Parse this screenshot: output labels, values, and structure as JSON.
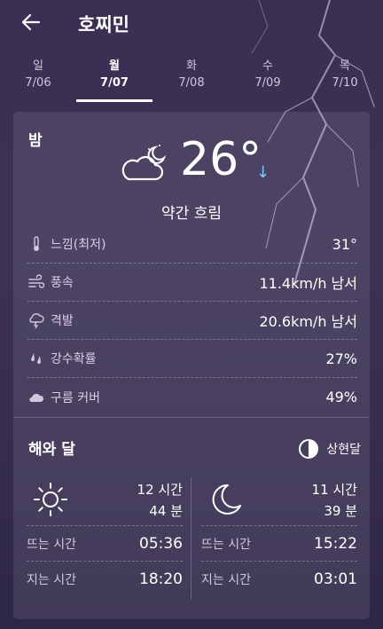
{
  "header": {
    "city": "호찌민"
  },
  "tabs": [
    {
      "day": "일",
      "date": "7/06"
    },
    {
      "day": "월",
      "date": "7/07"
    },
    {
      "day": "화",
      "date": "7/08"
    },
    {
      "day": "수",
      "date": "7/09"
    },
    {
      "day": "목",
      "date": "7/10"
    }
  ],
  "current": {
    "period": "밤",
    "temperature": "26°",
    "trend_arrow": "↓",
    "condition": "약간 흐림",
    "icon": "partly-cloudy-night-icon"
  },
  "details": [
    {
      "icon": "thermometer-icon",
      "label": "느낌(최저)",
      "value": "31°"
    },
    {
      "icon": "wind-icon",
      "label": "풍속",
      "value": "11.4km/h 남서"
    },
    {
      "icon": "gust-icon",
      "label": "격발",
      "value": "20.6km/h 남서"
    },
    {
      "icon": "rain-icon",
      "label": "강수확률",
      "value": "27%"
    },
    {
      "icon": "cloud-icon",
      "label": "구름 커버",
      "value": "49%"
    }
  ],
  "sun_moon": {
    "title": "해와 달",
    "moon_phase": "상현달",
    "sun": {
      "duration_hours": "12 시간",
      "duration_minutes": "44 분",
      "rise_label": "뜨는 시간",
      "rise": "05:36",
      "set_label": "지는 시간",
      "set": "18:20"
    },
    "moon": {
      "duration_hours": "11 시간",
      "duration_minutes": "39 분",
      "rise_label": "뜨는 시간",
      "rise": "15:22",
      "set_label": "지는 시간",
      "set": "03:01"
    }
  },
  "colors": {
    "background": "#3a2f52",
    "trend_arrow": "#7ec7f2"
  }
}
